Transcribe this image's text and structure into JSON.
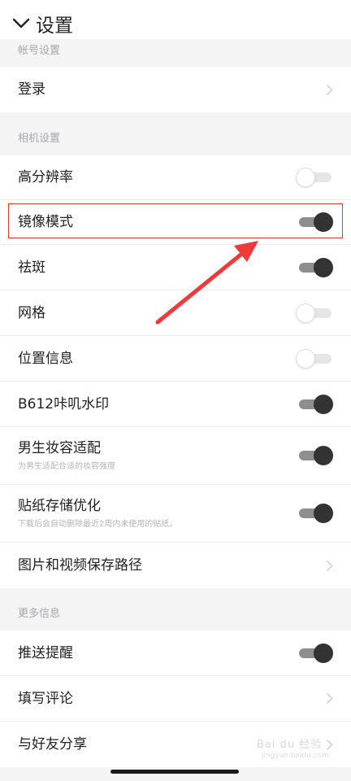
{
  "header": {
    "title": "设置"
  },
  "sections": {
    "account": "帐号设置",
    "camera": "相机设置",
    "more": "更多信息"
  },
  "rows": {
    "login": {
      "label": "登录"
    },
    "high_res": {
      "label": "高分辨率",
      "on": false
    },
    "mirror": {
      "label": "镜像模式",
      "on": true
    },
    "freckle": {
      "label": "祛斑",
      "on": true
    },
    "grid": {
      "label": "网格",
      "on": false
    },
    "location": {
      "label": "位置信息",
      "on": false
    },
    "watermark": {
      "label": "B612咔叽水印",
      "on": true
    },
    "male_makeup": {
      "label": "男生妆容适配",
      "sub": "为男生适配合适的妆容强度",
      "on": true
    },
    "sticker_opt": {
      "label": "贴纸存储优化",
      "sub": "下载后会自动删除最近2周内未使用的贴纸。",
      "on": true
    },
    "save_path": {
      "label": "图片和视频保存路径"
    },
    "push": {
      "label": "推送提醒",
      "on": true
    },
    "review": {
      "label": "填写评论"
    },
    "share": {
      "label": "与好友分享"
    }
  },
  "watermark": {
    "text": "Bai du 经验",
    "sub": "jingyan.baidu.com"
  },
  "colors": {
    "highlight": "#e53935",
    "toggle_on_knob": "#333333",
    "toggle_on_track": "#8e8e8e"
  }
}
